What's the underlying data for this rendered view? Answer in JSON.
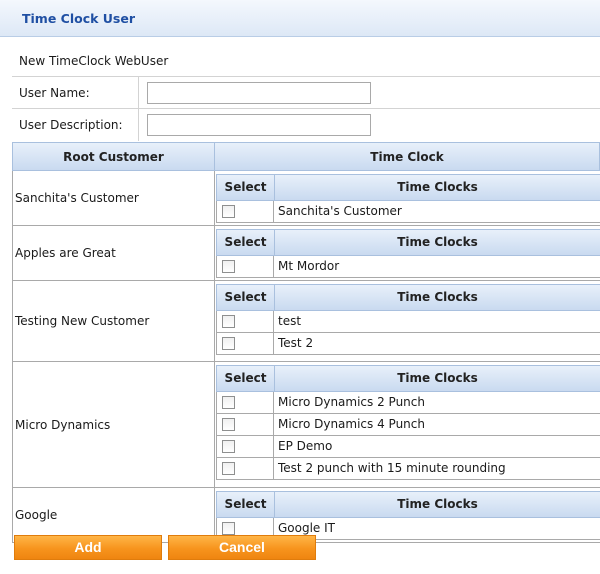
{
  "header": {
    "title": "Time Clock User"
  },
  "form": {
    "caption": "New TimeClock WebUser",
    "user_name": {
      "label": "User Name:",
      "value": ""
    },
    "user_description": {
      "label": "User Description:",
      "value": ""
    }
  },
  "grid": {
    "headers": {
      "root_customer": "Root Customer",
      "time_clock": "Time Clock"
    },
    "sub_headers": {
      "select": "Select",
      "time_clocks": "Time Clocks"
    },
    "groups": [
      {
        "customer": "Sanchita's Customer",
        "clocks": [
          {
            "name": "Sanchita's Customer",
            "checked": false
          }
        ]
      },
      {
        "customer": "Apples are Great",
        "clocks": [
          {
            "name": "Mt Mordor",
            "checked": false
          }
        ]
      },
      {
        "customer": "Testing New Customer",
        "clocks": [
          {
            "name": "test",
            "checked": false
          },
          {
            "name": "Test 2",
            "checked": false
          }
        ]
      },
      {
        "customer": "Micro Dynamics",
        "clocks": [
          {
            "name": "Micro Dynamics 2 Punch",
            "checked": false
          },
          {
            "name": "Micro Dynamics 4 Punch",
            "checked": false
          },
          {
            "name": "EP Demo",
            "checked": false
          },
          {
            "name": "Test 2 punch with 15 minute rounding",
            "checked": false
          }
        ]
      },
      {
        "customer": "Google",
        "clocks": [
          {
            "name": "Google IT",
            "checked": false
          }
        ]
      }
    ]
  },
  "buttons": {
    "add": "Add",
    "cancel": "Cancel"
  },
  "colors": {
    "accent": "#f7941d",
    "header_text": "#1f4fa3"
  }
}
